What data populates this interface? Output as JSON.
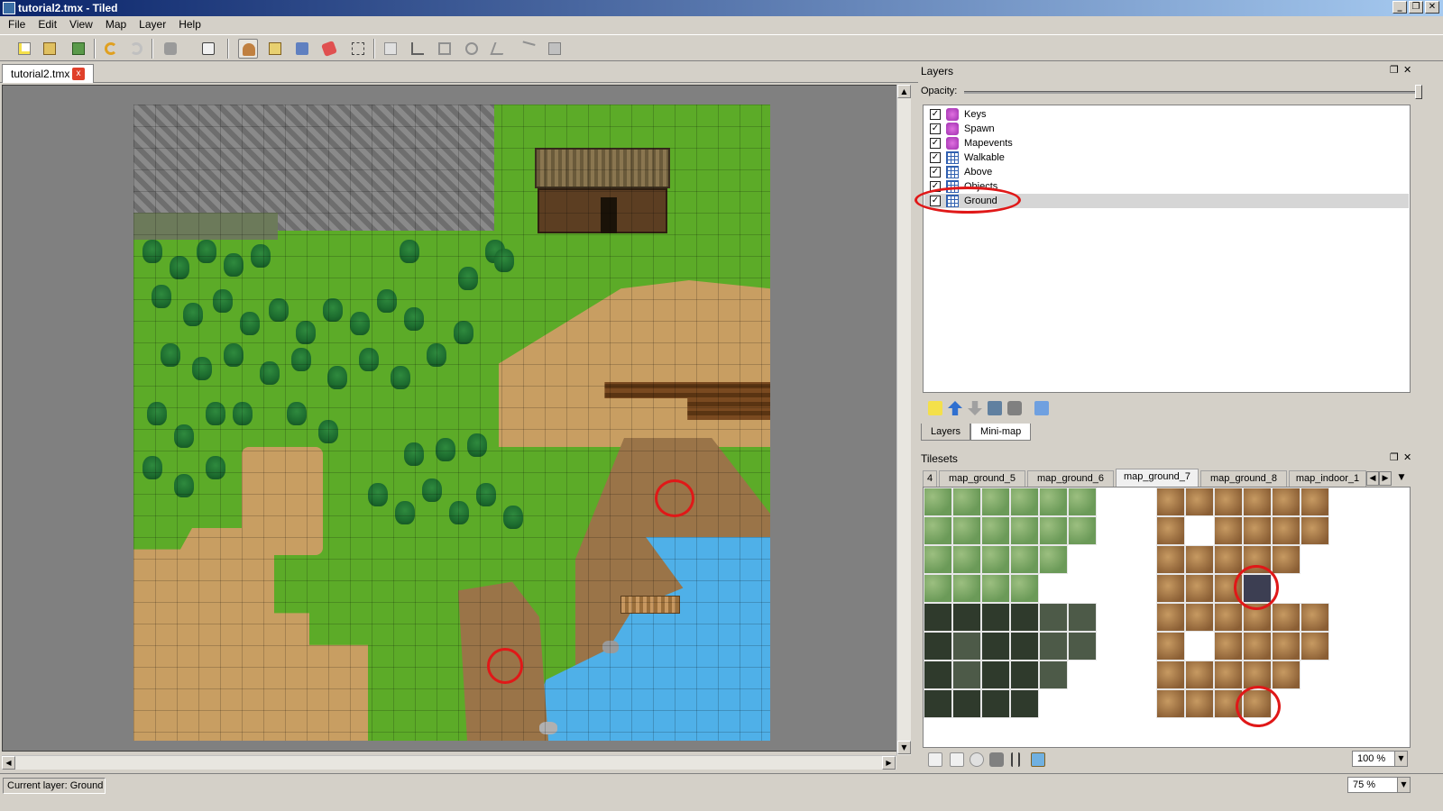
{
  "window": {
    "title": "tutorial2.tmx - Tiled",
    "min": "_",
    "max": "❐",
    "close": "✕"
  },
  "menu": [
    "File",
    "Edit",
    "View",
    "Map",
    "Layer",
    "Help"
  ],
  "toolbar": {
    "icons": [
      "new-file-icon",
      "open-file-icon",
      "save-file-icon",
      "undo-icon",
      "redo-icon",
      "random-icon",
      "dice-icon",
      "stamp-brush-icon",
      "terrain-brush-icon",
      "bucket-fill-icon",
      "eraser-icon",
      "rect-select-icon",
      "magic-wand-icon",
      "select-objects-icon",
      "edit-polygons-icon",
      "insert-rectangle-icon",
      "insert-ellipse-icon",
      "insert-polygon-icon",
      "insert-polyline-icon",
      "insert-tile-icon"
    ]
  },
  "document": {
    "tab_label": "tutorial2.tmx",
    "close_glyph": "x"
  },
  "layers_panel": {
    "title": "Layers",
    "opacity_label": "Opacity:",
    "opacity_value": 1.0,
    "layers": [
      {
        "name": "Keys",
        "type": "object",
        "visible": true,
        "selected": false
      },
      {
        "name": "Spawn",
        "type": "object",
        "visible": true,
        "selected": false
      },
      {
        "name": "Mapevents",
        "type": "object",
        "visible": true,
        "selected": false
      },
      {
        "name": "Walkable",
        "type": "tile",
        "visible": true,
        "selected": false
      },
      {
        "name": "Above",
        "type": "tile",
        "visible": true,
        "selected": false
      },
      {
        "name": "Objects",
        "type": "tile",
        "visible": true,
        "selected": false
      },
      {
        "name": "Ground",
        "type": "tile",
        "visible": true,
        "selected": true
      }
    ],
    "checkmark": "✓",
    "tabs": [
      "Layers",
      "Mini-map"
    ]
  },
  "tilesets_panel": {
    "title": "Tilesets",
    "tabs": [
      "4",
      "map_ground_5",
      "map_ground_6",
      "map_ground_7",
      "map_ground_8",
      "map_indoor_1"
    ],
    "active_tab": "map_ground_7",
    "zoom": "100 %"
  },
  "status": {
    "current_layer": "Current layer: Ground",
    "zoom": "75 %"
  },
  "colors": {
    "highlight_red": "#e01818",
    "grass": "#5cab28",
    "dirt": "#c49a5c",
    "water": "#4fb0e8",
    "rock": "#7a7a7a"
  }
}
